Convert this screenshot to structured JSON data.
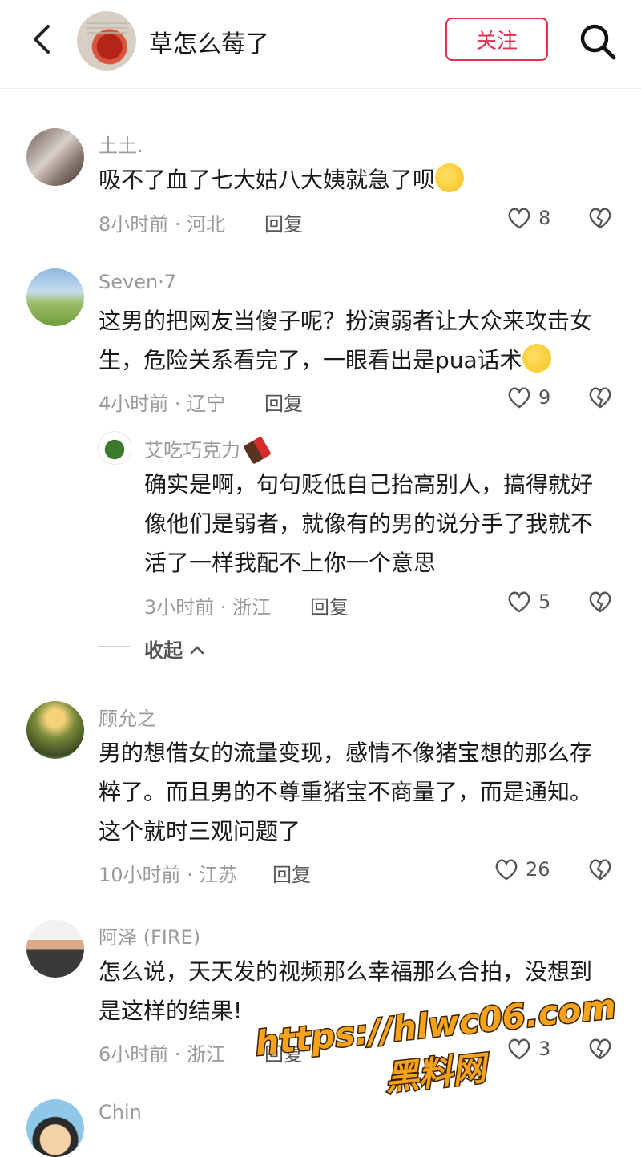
{
  "header": {
    "title": "草怎么莓了",
    "follow_label": "关注"
  },
  "comments": [
    {
      "username": "土土.",
      "text": "吸不了血了七大姑八大姨就急了呗",
      "meta": "8小时前 · 河北",
      "reply_label": "回复",
      "likes": "8"
    },
    {
      "username": "Seven·7",
      "text": "这男的把网友当傻子呢？扮演弱者让大众来攻击女生，危险关系看完了，一眼看出是pua话术",
      "meta": "4小时前 · 辽宁",
      "reply_label": "回复",
      "likes": "9"
    },
    {
      "username": "艾吃巧克力",
      "text": "确实是啊，句句贬低自己抬高别人，搞得就好像他们是弱者，就像有的男的说分手了我就不活了一样我配不上你一个意思",
      "meta": "3小时前 · 浙江",
      "reply_label": "回复",
      "likes": "5"
    },
    {
      "username": "顾允之",
      "text": "男的想借女的流量变现，感情不像猪宝想的那么存粹了。而且男的不尊重猪宝不商量了，而是通知。这个就时三观问题了",
      "meta": "10小时前 · 江苏",
      "reply_label": "回复",
      "likes": "26"
    },
    {
      "username": "阿泽 (FIRE)",
      "text": "怎么说，天天发的视频那么幸福那么合拍，没想到是这样的结果!",
      "meta": "6小时前 · 浙江",
      "reply_label": "回复",
      "likes": "3"
    },
    {
      "username": "Chin"
    }
  ],
  "collapse_label": "收起",
  "watermark": {
    "url": "https://hlwc06.com",
    "sub": "黑料网"
  }
}
